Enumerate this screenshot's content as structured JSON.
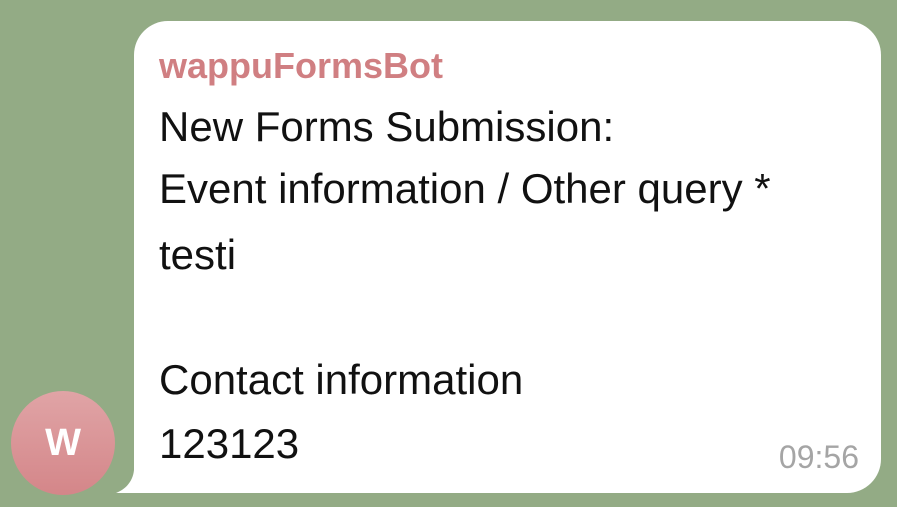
{
  "chat": {
    "background_color": "#93ab85",
    "avatar": {
      "letter": "W",
      "colors": [
        "#e0a4a6",
        "#d48689"
      ]
    },
    "message": {
      "sender": "wappuFormsBot",
      "sender_color": "#d07f82",
      "lines": [
        "New Forms Submission:",
        "Event information / Other query *",
        "testi",
        "",
        "Contact information",
        "123123"
      ],
      "time": "09:56"
    }
  }
}
